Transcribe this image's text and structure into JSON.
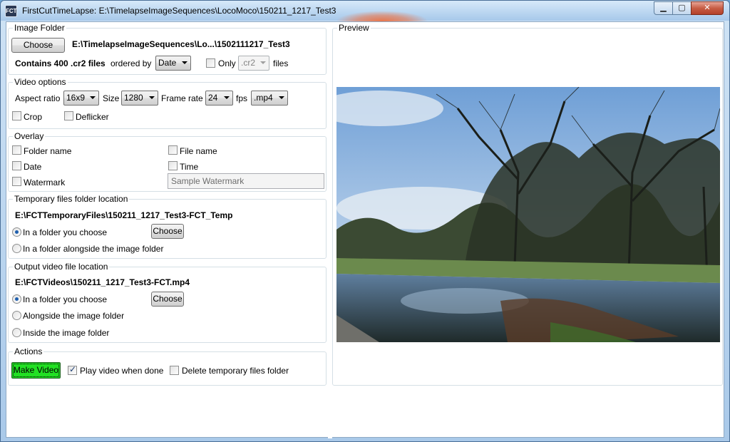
{
  "window": {
    "title": "FirstCutTimeLapse: E:\\TimelapseImageSequences\\LocoMoco\\150211_1217_Test3",
    "icon_label": "FCT",
    "icons": {
      "app": "app-icon",
      "minimize": "minimize-icon",
      "maximize": "maximize-icon",
      "close": "close-icon"
    }
  },
  "image_folder": {
    "legend": "Image Folder",
    "choose_label": "Choose",
    "path": "E:\\TimelapseImageSequences\\Lo...\\1502111217_Test3",
    "contains": "Contains 400 .cr2 files",
    "ordered_by_label": "ordered by",
    "ordered_by_value": "Date",
    "only_label": "Only",
    "only_checked": false,
    "only_ext": ".cr2",
    "files_label": "files"
  },
  "video_options": {
    "legend": "Video options",
    "aspect_label": "Aspect ratio",
    "aspect_value": "16x9",
    "size_label": "Size",
    "size_value": "1280",
    "framerate_label": "Frame rate",
    "framerate_value": "24",
    "fps_label": "fps",
    "format_value": ".mp4",
    "crop_label": "Crop",
    "deflicker_label": "Deflicker"
  },
  "overlay": {
    "legend": "Overlay",
    "folder_name": "Folder name",
    "file_name": "File name",
    "date": "Date",
    "time": "Time",
    "watermark": "Watermark",
    "watermark_placeholder": "Sample Watermark"
  },
  "temp_folder": {
    "legend": "Temporary files folder location",
    "path": "E:\\FCTTemporaryFiles\\150211_1217_Test3-FCT_Temp",
    "opt_choose": "In a folder you choose",
    "choose_label": "Choose",
    "opt_alongside": "In a folder alongside the image folder"
  },
  "output": {
    "legend": "Output video file location",
    "path": "E:\\FCTVideos\\150211_1217_Test3-FCT.mp4",
    "opt_choose": "In a folder you choose",
    "choose_label": "Choose",
    "opt_alongside": "Alongside the image folder",
    "opt_inside": "Inside the image folder"
  },
  "actions": {
    "legend": "Actions",
    "make_video": "Make Video",
    "play_when_done": "Play video when done",
    "play_checked": true,
    "delete_temp": "Delete temporary files folder"
  },
  "preview": {
    "legend": "Preview"
  },
  "colors": {
    "accent": "#22e023",
    "title_bar": "#bcd7f1",
    "group_border": "#d5dfe5"
  }
}
